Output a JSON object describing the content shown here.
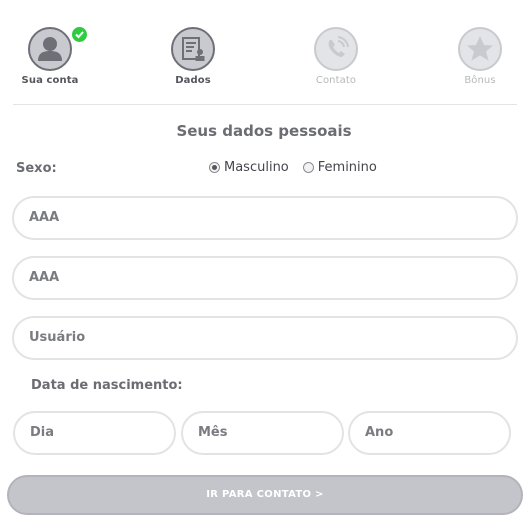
{
  "steps": [
    {
      "label": "Sua conta",
      "icon": "user-icon",
      "state": "done"
    },
    {
      "label": "Dados",
      "icon": "document-user-icon",
      "state": "active"
    },
    {
      "label": "Contato",
      "icon": "phone-icon",
      "state": "inactive"
    },
    {
      "label": "Bônus",
      "icon": "star-icon",
      "state": "inactive"
    }
  ],
  "form": {
    "title": "Seus dados pessoais",
    "sexo_label": "Sexo:",
    "sexo_options": [
      "Masculino",
      "Feminino"
    ],
    "sexo_selected": "Masculino",
    "first_name_value": "AAA",
    "last_name_value": "AAA",
    "username_placeholder": "Usuário",
    "dob_label": "Data de nascimento:",
    "dob_day_placeholder": "Dia",
    "dob_month_placeholder": "Mês",
    "dob_year_placeholder": "Ano",
    "submit_label": "IR PARA CONTATO >"
  },
  "colors": {
    "check": "#2ecc40",
    "button": "#c4c5ca",
    "field_border": "#e3e3e5"
  }
}
